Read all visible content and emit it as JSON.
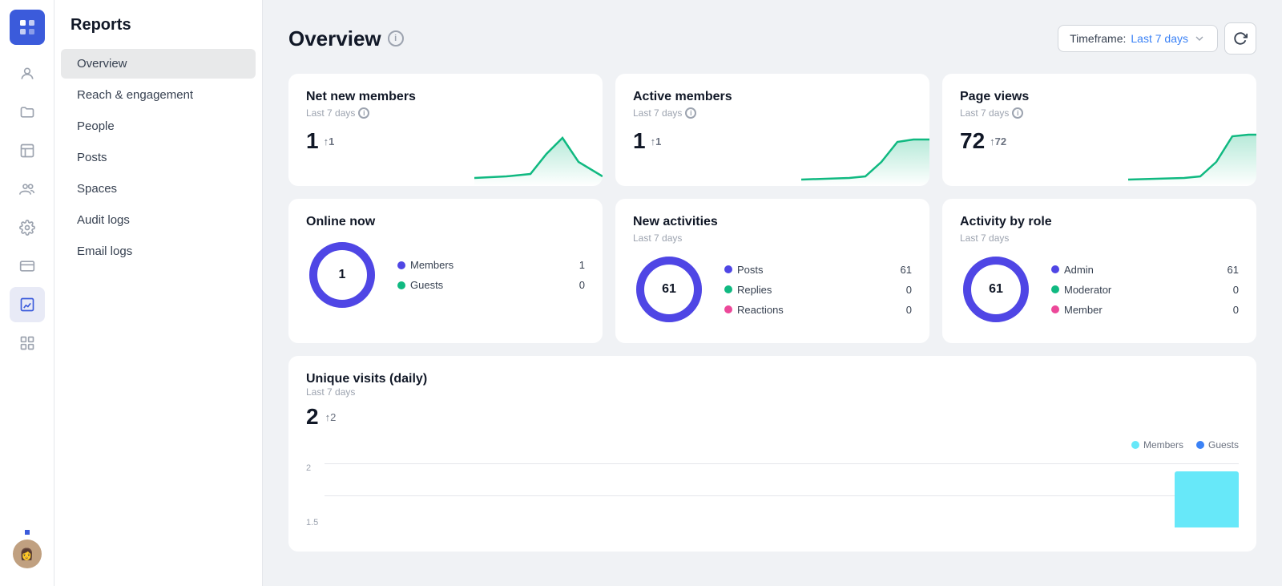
{
  "app": {
    "title": "Reports"
  },
  "nav": {
    "items": [
      {
        "id": "overview",
        "label": "Overview",
        "active": true
      },
      {
        "id": "reach",
        "label": "Reach & engagement",
        "active": false
      },
      {
        "id": "people",
        "label": "People",
        "active": false
      },
      {
        "id": "posts",
        "label": "Posts",
        "active": false
      },
      {
        "id": "spaces",
        "label": "Spaces",
        "active": false
      },
      {
        "id": "audit",
        "label": "Audit logs",
        "active": false
      },
      {
        "id": "email",
        "label": "Email logs",
        "active": false
      }
    ]
  },
  "page": {
    "title": "Overview",
    "timeframe_label": "Timeframe:",
    "timeframe_value": "Last 7 days",
    "refresh_icon": "↻"
  },
  "stats": {
    "net_new_members": {
      "title": "Net new members",
      "subtitle": "Last 7 days",
      "value": "1",
      "change": "↑1"
    },
    "active_members": {
      "title": "Active members",
      "subtitle": "Last 7 days",
      "value": "1",
      "change": "↑1"
    },
    "page_views": {
      "title": "Page views",
      "subtitle": "Last 7 days",
      "value": "72",
      "change": "↑72"
    }
  },
  "donuts": {
    "online_now": {
      "title": "Online now",
      "subtitle": "",
      "center_value": "1",
      "legend": [
        {
          "label": "Members",
          "color": "#4f46e5",
          "value": "1"
        },
        {
          "label": "Guests",
          "color": "#10b981",
          "value": "0"
        }
      ]
    },
    "new_activities": {
      "title": "New activities",
      "subtitle": "Last 7 days",
      "center_value": "61",
      "legend": [
        {
          "label": "Posts",
          "color": "#4f46e5",
          "value": "61"
        },
        {
          "label": "Replies",
          "color": "#10b981",
          "value": "0"
        },
        {
          "label": "Reactions",
          "color": "#ec4899",
          "value": "0"
        }
      ]
    },
    "activity_by_role": {
      "title": "Activity by role",
      "subtitle": "Last 7 days",
      "center_value": "61",
      "legend": [
        {
          "label": "Admin",
          "color": "#4f46e5",
          "value": "61"
        },
        {
          "label": "Moderator",
          "color": "#10b981",
          "value": "0"
        },
        {
          "label": "Member",
          "color": "#ec4899",
          "value": "0"
        }
      ]
    }
  },
  "unique_visits": {
    "title": "Unique visits (daily)",
    "subtitle": "Last 7 days",
    "value": "2",
    "change": "↑2",
    "legend": [
      {
        "label": "Members",
        "color": "#67e8f9"
      },
      {
        "label": "Guests",
        "color": "#3b82f6"
      }
    ],
    "y_labels": [
      "2",
      "1.5"
    ],
    "bar_value": 2
  },
  "icons": {
    "chat": "💬",
    "person": "👤",
    "folder": "📁",
    "grid": "⊞",
    "layout": "▦",
    "group": "👥",
    "settings": "⚙",
    "card": "▬",
    "chart": "📊",
    "apps": "⊞"
  }
}
